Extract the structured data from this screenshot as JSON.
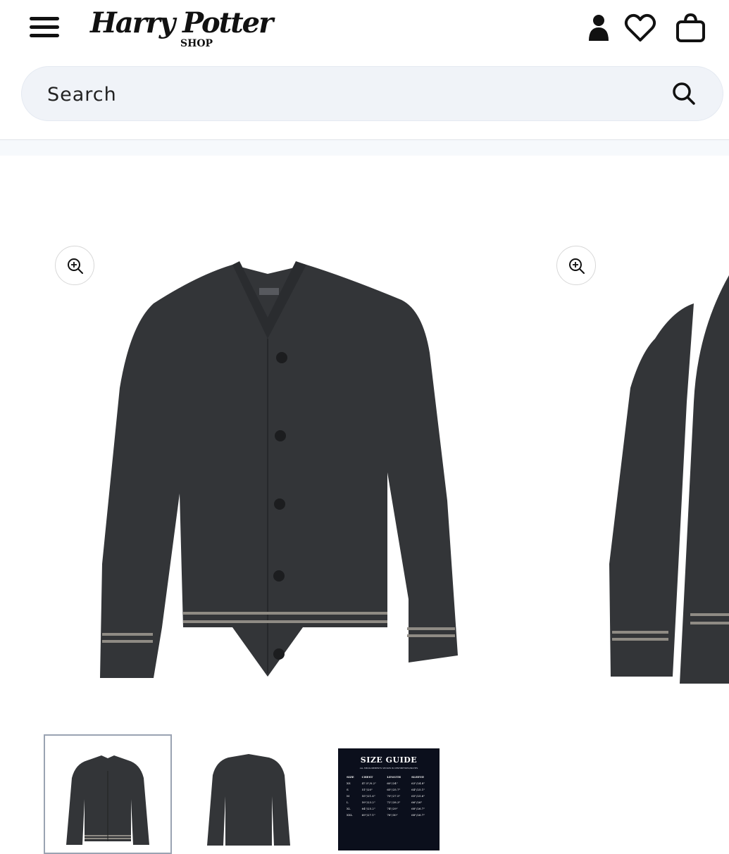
{
  "header": {
    "logo_text": "Harry Potter",
    "logo_subtext": "SHOP",
    "search": {
      "placeholder": "Search"
    }
  },
  "colors": {
    "text": "#121212",
    "search_bg": "#f0f3f8",
    "cardigan": "#333538",
    "stripe": "#8f8b84",
    "size_guide_bg": "#0b0f1c"
  },
  "gallery": {
    "main_image": "charcoal knit cardigan, front view",
    "second_image": "charcoal knit cardigan, back view (partially visible)"
  },
  "thumbnails": [
    {
      "name": "cardigan-front-thumbnail",
      "selected": true
    },
    {
      "name": "cardigan-back-thumbnail",
      "selected": false
    },
    {
      "name": "size-guide-thumbnail",
      "selected": false
    }
  ],
  "size_guide": {
    "title": "SIZE GUIDE",
    "subtitle": "ALL MEASUREMENTS SHOWN IN CENTIMETRES/INCHES",
    "headers": [
      "SIZE",
      "CHEST",
      "LENGTH",
      "SLEEVE"
    ],
    "rows": [
      [
        "XS",
        "47.5\"/0.2\"",
        "60\"/24\"",
        "63\"/24.8\""
      ],
      [
        "S",
        "51\"/20\"",
        "65\"/25.7\"",
        "64\"/25.1\""
      ],
      [
        "M",
        "55\"/21.6\"",
        "70\"/27.5\"",
        "65\"/25.6\""
      ],
      [
        "L",
        "59\"/23.2\"",
        "72\"/28.3\"",
        "66\"/26\""
      ],
      [
        "XL",
        "64\"/25.2\"",
        "74\"/29\"",
        "68\"/26.7\""
      ],
      [
        "XXL",
        "69\"/27.1\"",
        "76\"/30\"",
        "68\"/26.7\""
      ]
    ]
  }
}
